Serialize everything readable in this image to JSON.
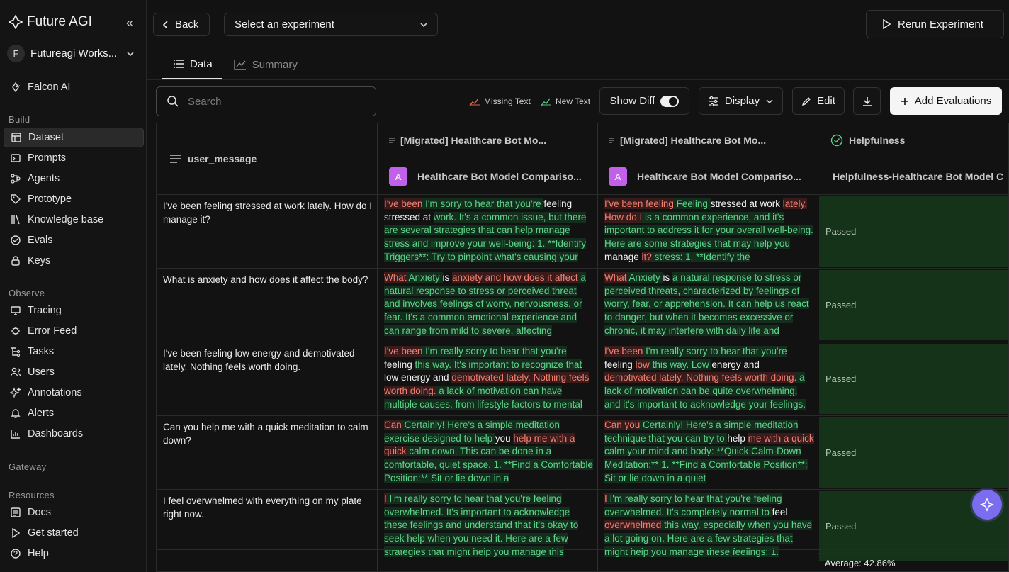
{
  "app": {
    "brand": "Future AGI",
    "workspace_initial": "F",
    "workspace_name": "Futureagi Works..."
  },
  "sidebar": {
    "falcon": "Falcon AI",
    "sections": {
      "build": "Build",
      "observe": "Observe",
      "gateway": "Gateway",
      "resources": "Resources"
    },
    "build_items": [
      {
        "label": "Dataset",
        "icon": "table-icon"
      },
      {
        "label": "Prompts",
        "icon": "prompt-icon"
      },
      {
        "label": "Agents",
        "icon": "agent-icon"
      },
      {
        "label": "Prototype",
        "icon": "tag-icon"
      },
      {
        "label": "Knowledge base",
        "icon": "library-icon"
      },
      {
        "label": "Evals",
        "icon": "check-circle-icon"
      },
      {
        "label": "Keys",
        "icon": "lock-icon"
      }
    ],
    "observe_items": [
      {
        "label": "Tracing",
        "icon": "monitor-icon"
      },
      {
        "label": "Error Feed",
        "icon": "bug-icon"
      },
      {
        "label": "Tasks",
        "icon": "tasks-icon"
      },
      {
        "label": "Users",
        "icon": "users-icon"
      },
      {
        "label": "Annotations",
        "icon": "sparkle-icon"
      },
      {
        "label": "Alerts",
        "icon": "bell-icon"
      },
      {
        "label": "Dashboards",
        "icon": "chart-icon"
      }
    ],
    "resource_items": [
      {
        "label": "Docs",
        "icon": "doc-icon"
      },
      {
        "label": "Get started",
        "icon": "play-icon"
      },
      {
        "label": "Help",
        "icon": "help-icon"
      }
    ]
  },
  "topbar": {
    "back": "Back",
    "experiment_select": "Select an experiment",
    "rerun": "Rerun Experiment"
  },
  "tabs": [
    {
      "label": "Data"
    },
    {
      "label": "Summary"
    }
  ],
  "toolbar": {
    "search_placeholder": "Search",
    "legend_missing": "Missing Text",
    "legend_new": "New Text",
    "show_diff": "Show Diff",
    "display": "Display",
    "edit": "Edit",
    "add_evaluations": "Add Evaluations"
  },
  "table": {
    "col_user": "user_message",
    "col_b_group": "[Migrated] Healthcare Bot Mo...",
    "col_b_sub": "Healthcare Bot Model Compariso...",
    "col_c_group": "[Migrated] Healthcare Bot Mo...",
    "col_c_sub": "Healthcare Bot Model Compariso...",
    "col_d_group": "Helpfulness",
    "col_d_sub": "Helpfulness-Healthcare Bot Model C",
    "badge": "A",
    "average": "Average: 42.86%",
    "rows": [
      {
        "user": "I've been feeling stressed at work lately. How do I manage it?",
        "b": [
          [
            "r",
            "I've been"
          ],
          [
            "g",
            " I'm sorry to hear that you're "
          ],
          [
            "n",
            " feeling stressed at "
          ],
          [
            "g",
            "work. It's a common issue, but there are several strategies that can help manage stress and improve your well-being: 1. **Identify Triggers**: Try to pinpoint what's causing your"
          ]
        ],
        "c": [
          [
            "r",
            "I've been feeling"
          ],
          [
            "g",
            " Feeling "
          ],
          [
            "n",
            " stressed at work "
          ],
          [
            "r",
            "lately. How do I"
          ],
          [
            "g",
            " is a common experience, and it's important to address it for your overall well-being. Here are some strategies that may help you "
          ],
          [
            "n",
            " manage "
          ],
          [
            "r",
            "it?"
          ],
          [
            "g",
            " stress: 1. **Identify the"
          ]
        ],
        "d": "Passed"
      },
      {
        "user": "What is anxiety and how does it affect the body?",
        "b": [
          [
            "r",
            "What"
          ],
          [
            "g",
            " Anxiety "
          ],
          [
            "n",
            " is "
          ],
          [
            "r",
            "anxiety and how does it affect"
          ],
          [
            "g",
            " a natural response to stress or perceived threat and involves feelings of worry, nervousness, or fear. It's a common emotional experience and can range from mild to severe, affecting"
          ]
        ],
        "c": [
          [
            "r",
            "What"
          ],
          [
            "g",
            " Anxiety "
          ],
          [
            "n",
            " is "
          ],
          [
            "g",
            "a natural response to stress or perceived threats, characterized by feelings of worry, fear, or apprehension. It can help us react to danger, but when it becomes excessive or chronic, it may interfere with daily life and"
          ]
        ],
        "d": "Passed"
      },
      {
        "user": "I've been feeling low energy and demotivated lately. Nothing feels worth doing.",
        "b": [
          [
            "r",
            "I've been"
          ],
          [
            "g",
            " I'm really sorry to hear that you're "
          ],
          [
            "n",
            " feeling "
          ],
          [
            "g",
            "this way. It's important to recognize that "
          ],
          [
            "n",
            " low energy and "
          ],
          [
            "r",
            "demotivated lately. Nothing feels worth doing."
          ],
          [
            "g",
            " a lack of motivation can have multiple causes, from lifestyle factors to mental"
          ]
        ],
        "c": [
          [
            "r",
            "I've been"
          ],
          [
            "g",
            " I'm really sorry to hear that you're "
          ],
          [
            "n",
            " feeling "
          ],
          [
            "r",
            "low"
          ],
          [
            "g",
            " this way. Low "
          ],
          [
            "n",
            " energy and "
          ],
          [
            "r",
            "demotivated lately. Nothing feels worth doing."
          ],
          [
            "g",
            " a lack of motivation can be quite overwhelming, and it's important to acknowledge your feelings."
          ]
        ],
        "d": "Passed"
      },
      {
        "user": "Can you help me with a quick meditation to calm down?",
        "b": [
          [
            "r",
            "Can"
          ],
          [
            "g",
            " Certainly! Here's a simple meditation exercise designed to help "
          ],
          [
            "n",
            " you "
          ],
          [
            "r",
            "help me with a quick"
          ],
          [
            "g",
            " calm down. This can be done in a comfortable, quiet space. 1. **Find a Comfortable Position:** Sit or lie down in a"
          ]
        ],
        "c": [
          [
            "r",
            "Can you"
          ],
          [
            "g",
            " Certainly! Here's a simple meditation technique that you can try to "
          ],
          [
            "n",
            " help "
          ],
          [
            "r",
            "me with a quick"
          ],
          [
            "g",
            " calm your mind and body: **Quick Calm-Down Meditation:** 1. **Find a Comfortable Position**: Sit or lie down in a quiet"
          ]
        ],
        "d": "Passed"
      },
      {
        "user": "I feel overwhelmed with everything on my plate right now.",
        "b": [
          [
            "r",
            "I"
          ],
          [
            "g",
            " I'm really sorry to hear that you're feeling overwhelmed. It's important to acknowledge these feelings and understand that it's okay to seek help when you need it. Here are a few strategies that might help you manage this"
          ]
        ],
        "c": [
          [
            "r",
            "I"
          ],
          [
            "g",
            " I'm really sorry to hear that you're feeling overwhelmed. It's completely normal to "
          ],
          [
            "n",
            " feel "
          ],
          [
            "r",
            "overwhelmed"
          ],
          [
            "g",
            " this way, especially when you have a lot going on. Here are a few strategies that might help you manage these feelings: 1."
          ]
        ],
        "d": "Passed"
      }
    ]
  },
  "colors": {
    "accent_fab": "#7b6cf0",
    "badge": "#c160e8",
    "passed_bg": "#143319",
    "missing": "#f08070",
    "new": "#5fd38a"
  }
}
